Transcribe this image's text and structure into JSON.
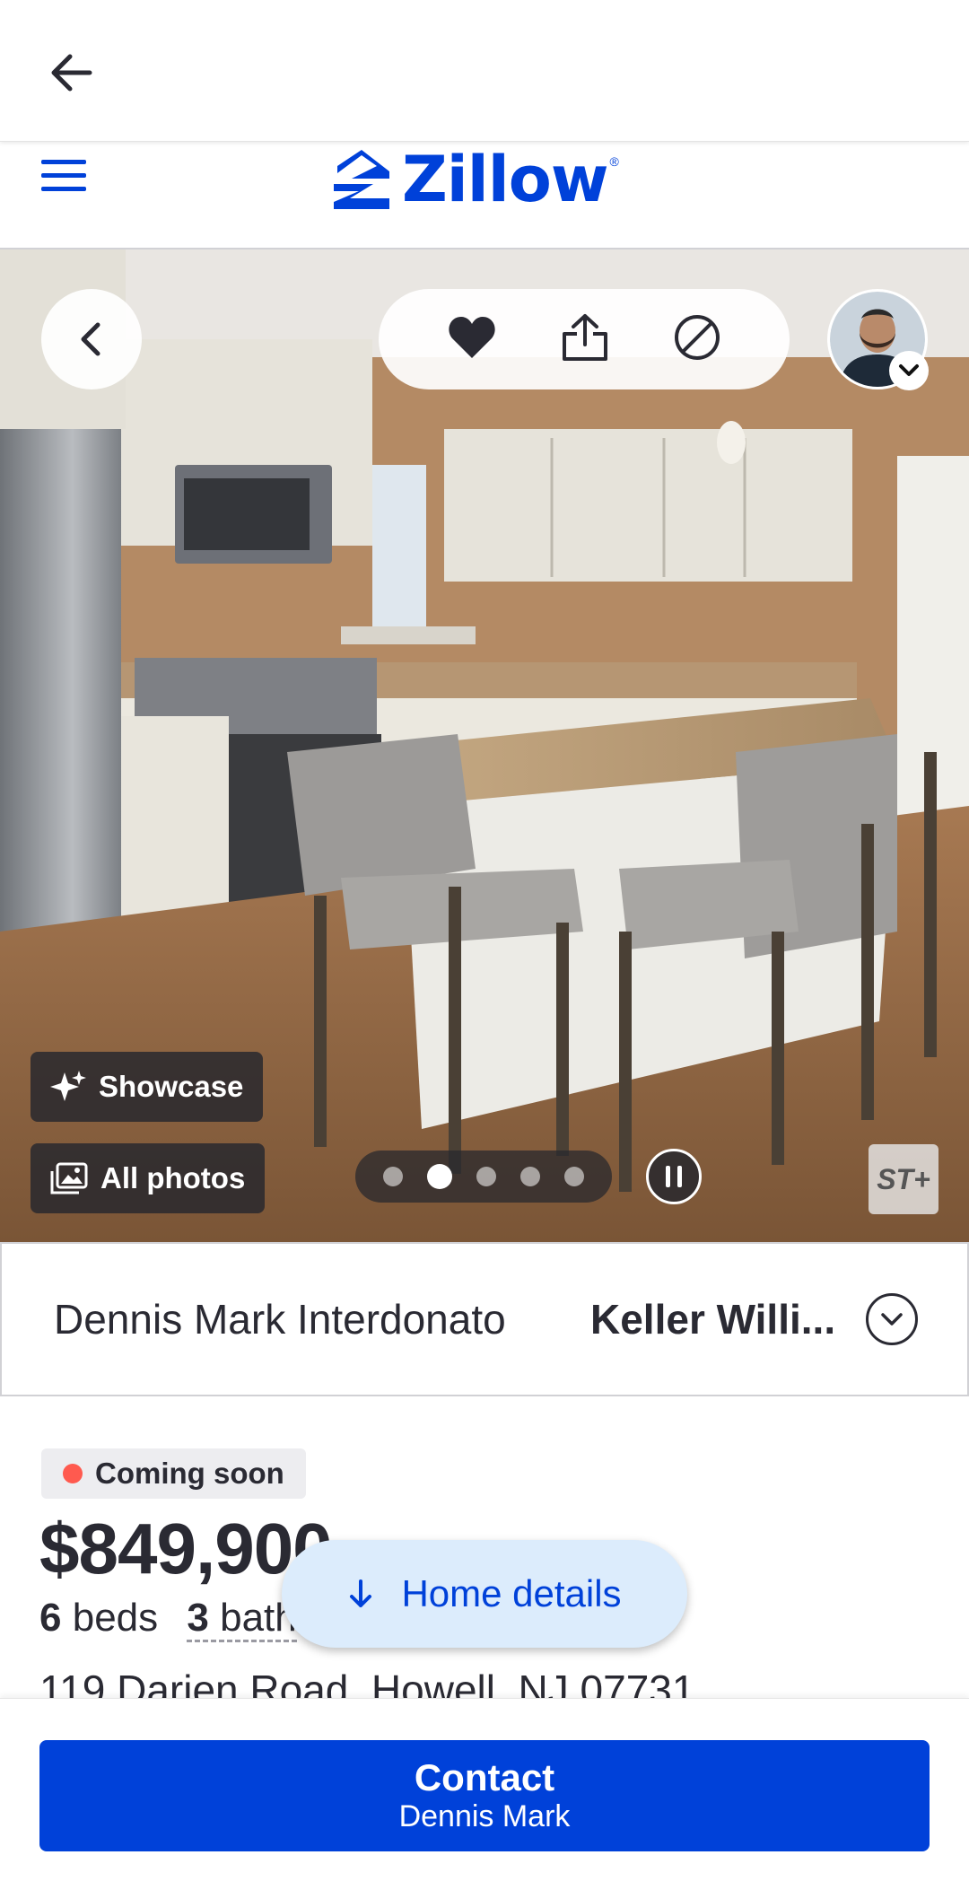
{
  "browser": {
    "back_icon": "arrow-left-icon"
  },
  "header": {
    "menu_icon": "hamburger-menu-icon",
    "logo_text": "Zillow",
    "logo_reg": "®"
  },
  "gallery": {
    "back_icon": "chevron-left-icon",
    "actions": [
      "heart-icon",
      "share-icon",
      "hide-icon"
    ],
    "avatar_icon": "agent-avatar",
    "showcase_label": "Showcase",
    "all_photos_label": "All photos",
    "photo_count": 5,
    "active_photo": 2,
    "st_badge": "ST+"
  },
  "agent": {
    "name": "Dennis Mark Interdonato",
    "brokerage": "Keller Willi..."
  },
  "listing": {
    "status": "Coming soon",
    "status_color": "#ff5a4f",
    "price": "$849,900",
    "beds_num": "6",
    "beds_label": "beds",
    "baths_num": "3",
    "baths_label": "bath",
    "address": "119 Darien Road, Howell, NJ 07731"
  },
  "floating": {
    "home_details_label": "Home details"
  },
  "contact": {
    "label": "Contact",
    "agent": "Dennis Mark",
    "color": "#0041d9"
  }
}
